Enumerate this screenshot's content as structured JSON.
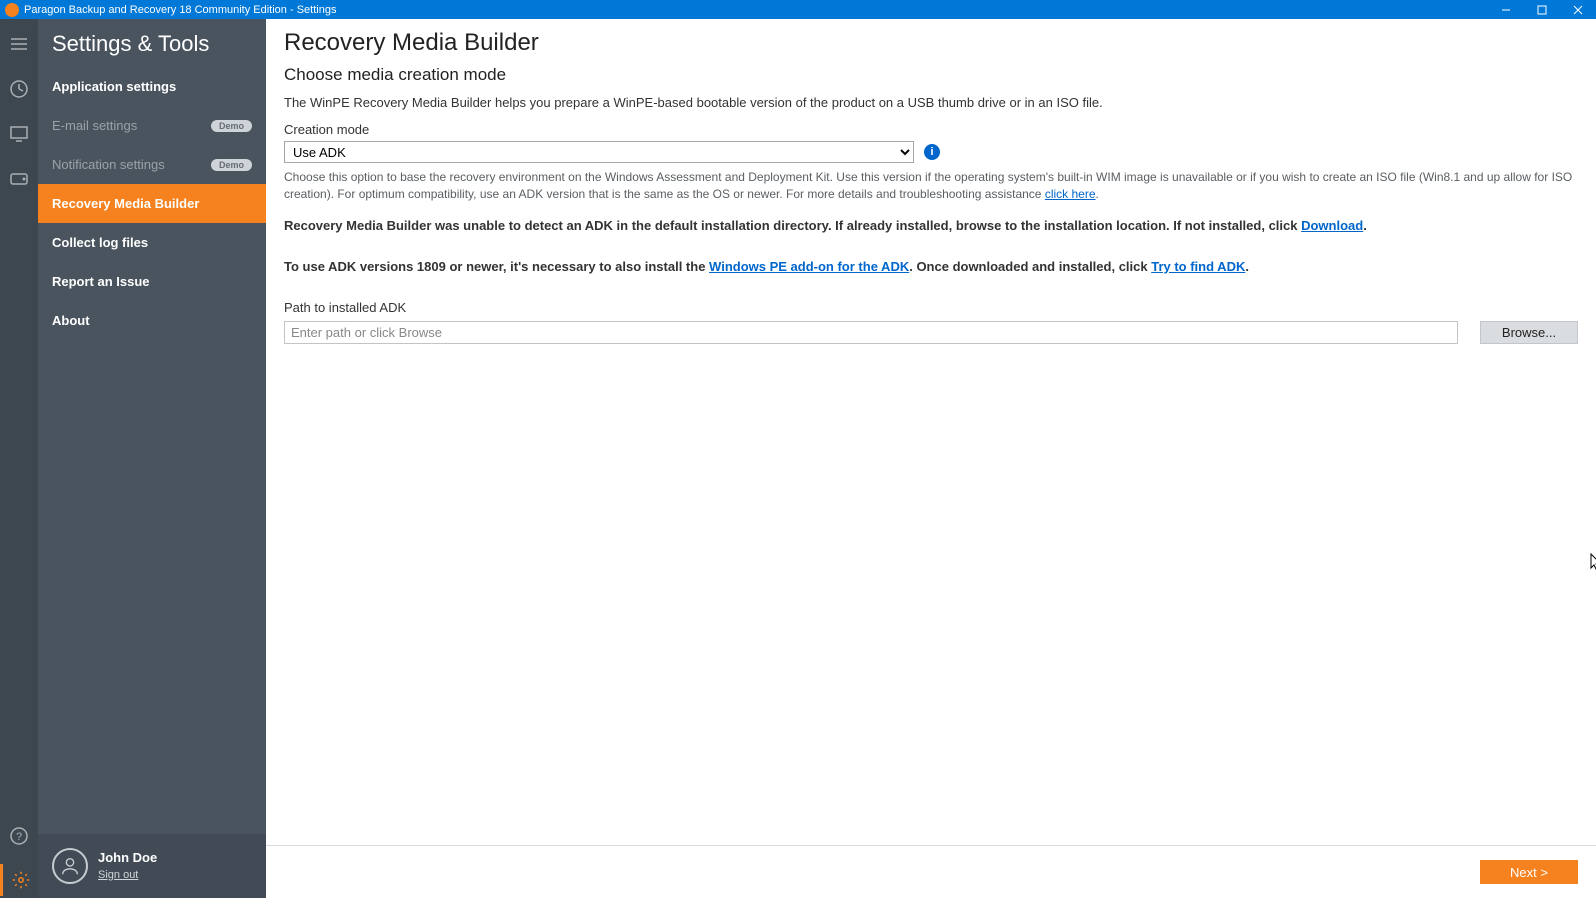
{
  "window": {
    "title": "Paragon Backup and Recovery 18 Community Edition - Settings"
  },
  "sidebar": {
    "title": "Settings & Tools",
    "items": [
      {
        "label": "Application settings",
        "badge": ""
      },
      {
        "label": "E-mail settings",
        "badge": "Demo"
      },
      {
        "label": "Notification settings",
        "badge": "Demo"
      },
      {
        "label": "Recovery Media Builder",
        "badge": ""
      },
      {
        "label": "Collect log files",
        "badge": ""
      },
      {
        "label": "Report an Issue",
        "badge": ""
      },
      {
        "label": "About",
        "badge": ""
      }
    ]
  },
  "user": {
    "name": "John Doe",
    "signout": "Sign out"
  },
  "main": {
    "heading": "Recovery Media Builder",
    "subheading": "Choose media creation mode",
    "intro": "The WinPE Recovery Media Builder helps you prepare a WinPE-based bootable version of the product on a USB thumb drive or in an ISO file.",
    "creation_mode_label": "Creation mode",
    "creation_mode_value": "Use ADK",
    "hint_pre": "Choose this option to base the recovery environment on the Windows Assessment and Deployment Kit. Use this version if the operating system's built-in WIM image is unavailable or if you wish to create an ISO file (Win8.1 and up allow for ISO creation). For optimum compatibility, use an ADK version that is the same as the OS or newer. For more details and troubleshooting assistance ",
    "hint_link": "click here",
    "detect_pre": "Recovery Media Builder was unable to detect an ADK in the default installation directory. If already installed, browse to the installation location. If not installed, click ",
    "detect_link": "Download",
    "adk_pre": "To use ADK versions 1809 or newer, it's necessary to also install the ",
    "adk_link1": "Windows PE add-on for the ADK",
    "adk_mid": ". Once downloaded and installed, click ",
    "adk_link2": "Try to find ADK",
    "path_label": "Path to installed ADK",
    "path_placeholder": "Enter path or click Browse",
    "browse": "Browse...",
    "next": "Next >"
  }
}
